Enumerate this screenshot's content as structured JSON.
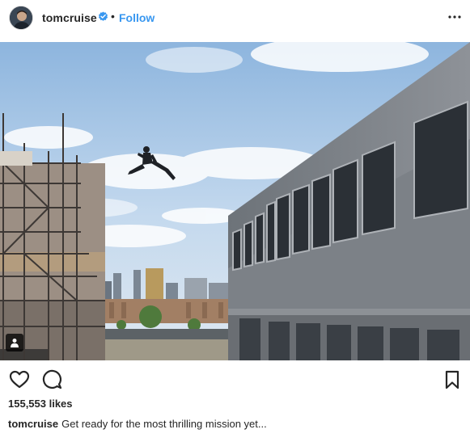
{
  "header": {
    "username": "tomcruise",
    "separator": "•",
    "follow_label": "Follow"
  },
  "photo": {
    "subject": "man leaping between rooftops over city",
    "has_tags": true
  },
  "actions": {
    "icons": [
      "heart-icon",
      "comment-icon",
      "bookmark-icon"
    ]
  },
  "likes": "155,553 likes",
  "caption": {
    "username": "tomcruise",
    "text": "Get ready for the most thrilling mission yet..."
  },
  "colors": {
    "link": "#3897f0",
    "verified": "#3897f0",
    "text": "#262626"
  }
}
